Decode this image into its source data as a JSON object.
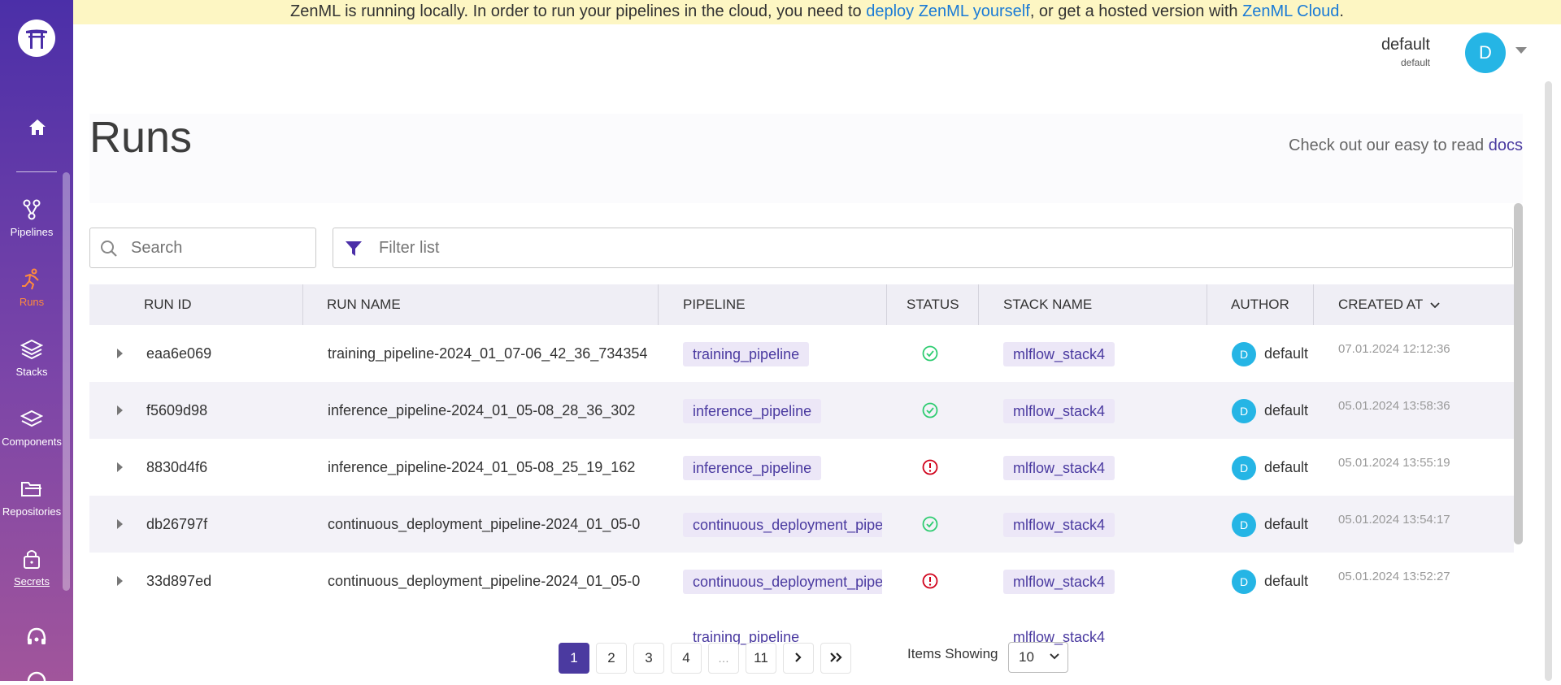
{
  "banner": {
    "text_before": "ZenML is running locally. In order to run your pipelines in the cloud, you need to ",
    "link1": "deploy ZenML yourself",
    "text_middle": ", or get a hosted version with ",
    "link2": "ZenML Cloud",
    "text_after": "."
  },
  "user": {
    "name": "default",
    "workspace": "default",
    "avatar_initial": "D"
  },
  "sidebar": {
    "items": [
      {
        "label": "Pipelines",
        "icon": "pipelines-icon"
      },
      {
        "label": "Runs",
        "icon": "runs-icon",
        "active": true
      },
      {
        "label": "Stacks",
        "icon": "stacks-icon"
      },
      {
        "label": "Components",
        "icon": "components-icon"
      },
      {
        "label": "Repositories",
        "icon": "repositories-icon"
      },
      {
        "label": "Secrets",
        "icon": "secrets-icon"
      }
    ]
  },
  "page": {
    "title": "Runs",
    "docs_prefix": "Check out our easy to read ",
    "docs_link": "docs"
  },
  "search": {
    "placeholder": "Search"
  },
  "filter": {
    "placeholder": "Filter list"
  },
  "table": {
    "columns": [
      "RUN ID",
      "RUN NAME",
      "PIPELINE",
      "STATUS",
      "STACK NAME",
      "AUTHOR",
      "CREATED AT"
    ],
    "rows": [
      {
        "id": "eaa6e069",
        "name": "training_pipeline-2024_01_07-06_42_36_734354",
        "pipeline": "training_pipeline",
        "status": "completed",
        "stack": "mlflow_stack4",
        "author": "default",
        "author_initial": "D",
        "created": "07.01.2024 12:12:36"
      },
      {
        "id": "f5609d98",
        "name": "inference_pipeline-2024_01_05-08_28_36_302",
        "pipeline": "inference_pipeline",
        "status": "completed",
        "stack": "mlflow_stack4",
        "author": "default",
        "author_initial": "D",
        "created": "05.01.2024 13:58:36"
      },
      {
        "id": "8830d4f6",
        "name": "inference_pipeline-2024_01_05-08_25_19_162",
        "pipeline": "inference_pipeline",
        "status": "failed",
        "stack": "mlflow_stack4",
        "author": "default",
        "author_initial": "D",
        "created": "05.01.2024 13:55:19"
      },
      {
        "id": "db26797f",
        "name": "continuous_deployment_pipeline-2024_01_05-0",
        "pipeline": "continuous_deployment_pipeline",
        "status": "completed",
        "stack": "mlflow_stack4",
        "author": "default",
        "author_initial": "D",
        "created": "05.01.2024 13:54:17"
      },
      {
        "id": "33d897ed",
        "name": "continuous_deployment_pipeline-2024_01_05-0",
        "pipeline": "continuous_deployment_pipeline",
        "status": "failed",
        "stack": "mlflow_stack4",
        "author": "default",
        "author_initial": "D",
        "created": "05.01.2024 13:52:27"
      }
    ],
    "partial_row": {
      "pipeline": "training_pipeline",
      "stack": "mlflow_stack4"
    }
  },
  "pagination": {
    "pages": [
      "1",
      "2",
      "3",
      "4",
      "…",
      "11"
    ],
    "current": "1",
    "items_label": "Items Showing",
    "items_value": "10"
  },
  "colors": {
    "accent": "#4b3aa0",
    "success": "#2ecc71",
    "danger": "#d0021b",
    "avatar": "#25b5e5",
    "runs_active": "#ff8a3d"
  }
}
